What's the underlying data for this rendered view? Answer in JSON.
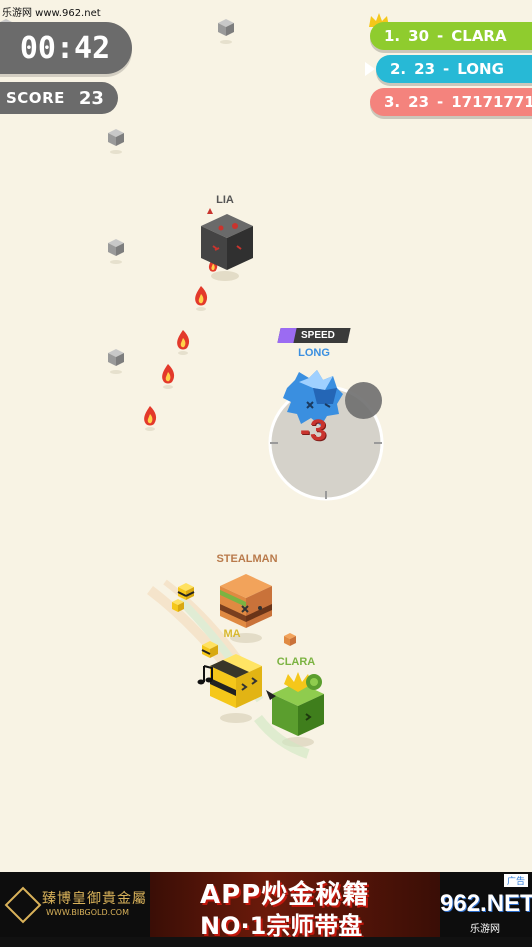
{
  "watermark": "乐游网 www.962.net",
  "hud": {
    "timer": "00:42",
    "score_label": "SCORE",
    "score_value": "23"
  },
  "leaderboard": [
    {
      "rank": "1.",
      "score": "30",
      "sep": "-",
      "name": "CLARA",
      "color": "#8fcc2e"
    },
    {
      "rank": "2.",
      "score": "23",
      "sep": "-",
      "name": "LONG",
      "color": "#27b9d6"
    },
    {
      "rank": "3.",
      "score": "23",
      "sep": "-",
      "name": "17171771",
      "color": "#f4837d"
    }
  ],
  "players": {
    "lia": {
      "name": "LIA",
      "color": "#555555"
    },
    "long": {
      "name": "LONG",
      "color": "#3b8fe0"
    },
    "stealman": {
      "name": "STEALMAN",
      "color": "#b97a4b"
    },
    "clara": {
      "name": "CLARA",
      "color": "#7cb342"
    },
    "ma": {
      "name": "MA",
      "color": "#d8b830"
    }
  },
  "powerup": {
    "label": "SPEED",
    "color": "#9b6bf2"
  },
  "damage_text": "-3",
  "ad": {
    "brand": "臻博皇御貴金屬",
    "domain": "WWW.BIBGOLD.COM",
    "line1": "APP炒金秘籍",
    "line2": "NO·1宗师带盘",
    "tag": "广告",
    "site": "962.NET",
    "site_sub": "乐游网"
  },
  "icons": [
    "crown-icon",
    "pointer-icon",
    "flame-icon",
    "gray-cube-icon",
    "joystick-icon",
    "music-note-icon"
  ]
}
